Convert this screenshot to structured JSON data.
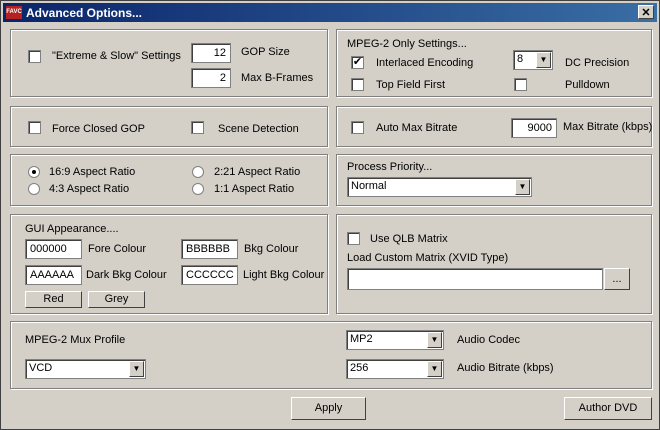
{
  "window": {
    "title": "Advanced Options...",
    "app_icon_text": "FAVC",
    "close_glyph": "✕"
  },
  "encoding": {
    "extreme_slow_label": "\"Extreme & Slow\" Settings",
    "extreme_slow_checked": false,
    "gop_size_value": "12",
    "gop_size_label": "GOP Size",
    "max_bframes_value": "2",
    "max_bframes_label": "Max B-Frames"
  },
  "mpeg2": {
    "title": "MPEG-2 Only Settings...",
    "interlaced_label": "Interlaced Encoding",
    "interlaced_checked": true,
    "top_field_label": "Top Field First",
    "top_field_checked": false,
    "dc_precision_value": "8",
    "dc_precision_label": "DC Precision",
    "pulldown_label": "Pulldown",
    "pulldown_checked": false
  },
  "gop": {
    "force_closed_label": "Force Closed GOP",
    "scene_detection_label": "Scene Detection"
  },
  "bitrate": {
    "auto_max_label": "Auto Max Bitrate",
    "max_bitrate_value": "9000",
    "max_bitrate_label": "Max Bitrate (kbps)"
  },
  "aspect": {
    "opt_169": "16:9 Aspect Ratio",
    "opt_221": "2:21 Aspect Ratio",
    "opt_43": "4:3 Aspect Ratio",
    "opt_11": "1:1 Aspect Ratio",
    "selected": "16:9 Aspect Ratio"
  },
  "priority": {
    "title": "Process Priority...",
    "value": "Normal"
  },
  "gui": {
    "title": "GUI Appearance....",
    "fore_value": "000000",
    "fore_label": "Fore Colour",
    "bkg_value": "BBBBBB",
    "bkg_label": "Bkg Colour",
    "dark_value": "AAAAAA",
    "dark_label": "Dark Bkg Colour",
    "light_value": "CCCCCC",
    "light_label": "Light Bkg Colour",
    "red_label": "Red",
    "grey_label": "Grey"
  },
  "matrix": {
    "qlb_label": "Use QLB Matrix",
    "custom_label": "Load Custom Matrix (XVID Type)",
    "path_value": "",
    "browse_label": "..."
  },
  "mux": {
    "profile_label": "MPEG-2 Mux Profile",
    "profile_value": "VCD",
    "audio_codec_value": "MP2",
    "audio_codec_label": "Audio Codec",
    "audio_bitrate_value": "256",
    "audio_bitrate_label": "Audio Bitrate (kbps)"
  },
  "footer": {
    "apply_label": "Apply",
    "author_dvd_label": "Author DVD"
  },
  "colors": {
    "titlebar_start": "#0a246a",
    "titlebar_end": "#3a6ea5",
    "face": "#d4d0c8"
  },
  "icons": {
    "check": "✔",
    "dropdown_arrow": "▼"
  }
}
